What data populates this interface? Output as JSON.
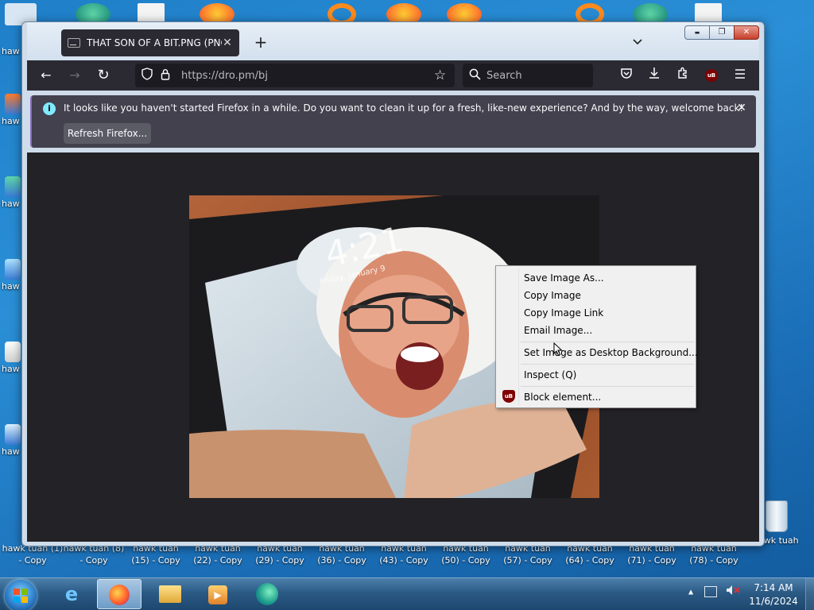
{
  "desktop": {
    "left_icons": [
      {
        "label": "haw"
      },
      {
        "label": "haw"
      },
      {
        "label": "haw"
      },
      {
        "label": "haw"
      },
      {
        "label": "haw"
      },
      {
        "label": "haw"
      }
    ],
    "bottom_icons": [
      {
        "line1": "hawk tuah (1)",
        "line2": "- Copy"
      },
      {
        "line1": "hawk tuah (8)",
        "line2": "- Copy"
      },
      {
        "line1": "hawk tuah",
        "line2": "(15) - Copy"
      },
      {
        "line1": "hawk tuah",
        "line2": "(22) - Copy"
      },
      {
        "line1": "hawk tuah",
        "line2": "(29) - Copy"
      },
      {
        "line1": "hawk tuah",
        "line2": "(36) - Copy"
      },
      {
        "line1": "hawk tuah",
        "line2": "(43) - Copy"
      },
      {
        "line1": "hawk tuah",
        "line2": "(50) - Copy"
      },
      {
        "line1": "hawk tuah",
        "line2": "(57) - Copy"
      },
      {
        "line1": "hawk tuah",
        "line2": "(64) - Copy"
      },
      {
        "line1": "hawk tuah",
        "line2": "(71) - Copy"
      },
      {
        "line1": "hawk tuah",
        "line2": "(78) - Copy"
      }
    ],
    "recycle_label": "hawk tuah"
  },
  "browser": {
    "tab": {
      "title": "THAT SON OF A BIT.PNG (PNG",
      "close_icon": "close-icon"
    },
    "new_tab_glyph": "+",
    "tab_list_glyph": "⌄",
    "window_buttons": {
      "minimize": "▬",
      "maximize": "❐",
      "close": "✕"
    },
    "nav": {
      "back": "←",
      "forward": "→",
      "reload": "↻"
    },
    "url": "https://dro.pm/bj",
    "search_placeholder": "Search",
    "ublock_badge": "uB",
    "notification": {
      "message": "It looks like you haven't started Firefox in a while. Do you want to clean it up for a fresh, like-new experience? And by the way, welcome back!",
      "button": "Refresh Firefox...",
      "info_glyph": "i",
      "close_glyph": "✕"
    },
    "image_overlay": {
      "clock_time": "4:21",
      "clock_date": "Friday, January 9"
    }
  },
  "context_menu": {
    "items": [
      "Save Image As...",
      "Copy Image",
      "Copy Image Link",
      "Email Image...",
      "Set Image as Desktop Background...",
      "Inspect (Q)",
      "Block element..."
    ]
  },
  "taskbar": {
    "time": "7:14 AM",
    "date": "11/6/2024",
    "tray_arrow": "▲"
  }
}
